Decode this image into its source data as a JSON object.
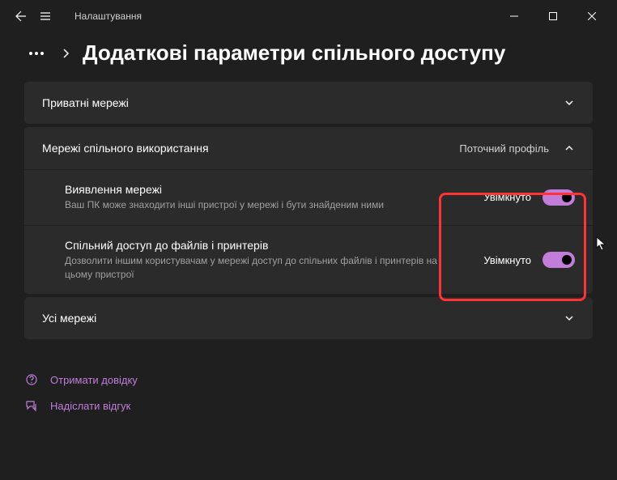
{
  "titlebar": {
    "title": "Налаштування"
  },
  "page": {
    "title": "Додаткові параметри спільного доступу"
  },
  "sections": {
    "private": {
      "title": "Приватні мережі"
    },
    "shared": {
      "title": "Мережі спільного використання",
      "profile_label": "Поточний профіль",
      "items": [
        {
          "title": "Виявлення мережі",
          "desc": "Ваш ПК може знаходити інші пристрої у мережі і бути знайденим ними",
          "state_label": "Увімкнуто"
        },
        {
          "title": "Спільний доступ до файлів і принтерів",
          "desc": "Дозволити іншим користувачам у мережі доступ до спільних файлів і принтерів на цьому пристрої",
          "state_label": "Увімкнуто"
        }
      ]
    },
    "all": {
      "title": "Усі мережі"
    }
  },
  "footer": {
    "help": "Отримати довідку",
    "feedback": "Надіслати відгук"
  }
}
